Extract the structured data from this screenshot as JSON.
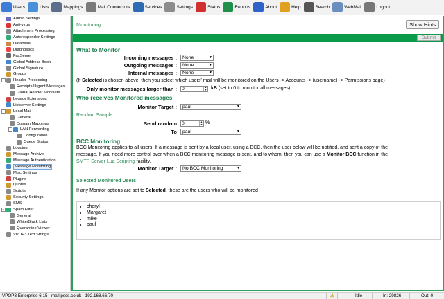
{
  "toolbar": [
    {
      "name": "users",
      "label": "Users",
      "color": "#3b7dd8"
    },
    {
      "name": "lists",
      "label": "Lists",
      "color": "#4a90d9"
    },
    {
      "name": "mappings",
      "label": "Mappings",
      "color": "#5c6e8a"
    },
    {
      "name": "mail-connectors",
      "label": "Mail Connectors",
      "color": "#7a7a7a"
    },
    {
      "name": "services",
      "label": "Services",
      "color": "#2d6bb5"
    },
    {
      "name": "settings",
      "label": "Settings",
      "color": "#8c8c8c"
    },
    {
      "name": "status",
      "label": "Status",
      "color": "#d03030"
    },
    {
      "name": "reports",
      "label": "Reports",
      "color": "#1f8f4a"
    },
    {
      "name": "about",
      "label": "About",
      "color": "#2f63c9"
    },
    {
      "name": "help",
      "label": "Help",
      "color": "#e0a020"
    },
    {
      "name": "search",
      "label": "Search",
      "color": "#555555"
    },
    {
      "name": "webmail",
      "label": "WebMail",
      "color": "#6a8fbf"
    },
    {
      "name": "logout",
      "label": "Logout",
      "color": "#777777"
    }
  ],
  "sidebar": [
    {
      "label": "Admin Settings",
      "level": 0,
      "exp": "",
      "color": "#6a6ac8"
    },
    {
      "label": "Anti-virus",
      "level": 0,
      "exp": "",
      "color": "#d33"
    },
    {
      "label": "Attachment Processing",
      "level": 0,
      "exp": "",
      "color": "#888"
    },
    {
      "label": "Autoresponder Settings",
      "level": 0,
      "exp": "",
      "color": "#3a7"
    },
    {
      "label": "Database",
      "level": 0,
      "exp": "",
      "color": "#c84"
    },
    {
      "label": "Diagnostics",
      "level": 0,
      "exp": "",
      "color": "#e44"
    },
    {
      "label": "FaxServer",
      "level": 0,
      "exp": "",
      "color": "#666"
    },
    {
      "label": "Global Address Book",
      "level": 0,
      "exp": "",
      "color": "#48c"
    },
    {
      "label": "Global Signature",
      "level": 0,
      "exp": "",
      "color": "#888"
    },
    {
      "label": "Groups",
      "level": 0,
      "exp": "",
      "color": "#c93"
    },
    {
      "label": "Header Processing",
      "level": 0,
      "exp": "−",
      "color": "#888"
    },
    {
      "label": "Receipts/Urgent Messages",
      "level": 1,
      "exp": "",
      "color": "#888"
    },
    {
      "label": "Global Header Modifiers",
      "level": 1,
      "exp": "",
      "color": "#888"
    },
    {
      "label": "Legacy Extensions",
      "level": 0,
      "exp": "",
      "color": "#c44"
    },
    {
      "label": "Listserver Settings",
      "level": 0,
      "exp": "",
      "color": "#48c"
    },
    {
      "label": "Local Mail",
      "level": 0,
      "exp": "−",
      "color": "#c93"
    },
    {
      "label": "General",
      "level": 1,
      "exp": "",
      "color": "#888"
    },
    {
      "label": "Domain Mappings",
      "level": 1,
      "exp": "",
      "color": "#888"
    },
    {
      "label": "LAN Forwarding",
      "level": 1,
      "exp": "−",
      "color": "#48c"
    },
    {
      "label": "Configuration",
      "level": 2,
      "exp": "",
      "color": "#888"
    },
    {
      "label": "Queue Status",
      "level": 2,
      "exp": "",
      "color": "#888"
    },
    {
      "label": "Logging",
      "level": 0,
      "exp": "",
      "color": "#888"
    },
    {
      "label": "Message Archive",
      "level": 0,
      "exp": "",
      "color": "#c93"
    },
    {
      "label": "Message Authentication",
      "level": 0,
      "exp": "",
      "color": "#3a7"
    },
    {
      "label": "Message Monitoring",
      "level": 0,
      "exp": "",
      "color": "#48c",
      "selected": true
    },
    {
      "label": "Misc Settings",
      "level": 0,
      "exp": "",
      "color": "#888"
    },
    {
      "label": "Plugins",
      "level": 0,
      "exp": "",
      "color": "#c44"
    },
    {
      "label": "Quotas",
      "level": 0,
      "exp": "",
      "color": "#c93"
    },
    {
      "label": "Scripts",
      "level": 0,
      "exp": "",
      "color": "#888"
    },
    {
      "label": "Security Settings",
      "level": 0,
      "exp": "",
      "color": "#c93"
    },
    {
      "label": "SMS",
      "level": 0,
      "exp": "",
      "color": "#888"
    },
    {
      "label": "Spam Filter",
      "level": 0,
      "exp": "−",
      "color": "#3a7"
    },
    {
      "label": "General",
      "level": 1,
      "exp": "",
      "color": "#888"
    },
    {
      "label": "White/Black Lists",
      "level": 1,
      "exp": "",
      "color": "#888"
    },
    {
      "label": "Quarantine Viewer",
      "level": 1,
      "exp": "",
      "color": "#888"
    },
    {
      "label": "VPOP3 Text Strings",
      "level": 0,
      "exp": "",
      "color": "#888"
    }
  ],
  "main": {
    "title": "Monitoring",
    "hints_label": "Show Hints",
    "submit_label": "Submit",
    "what_heading": "What to Monitor",
    "incoming_label": "Incoming messages :",
    "incoming_value": "None",
    "outgoing_label": "Outgoing messages :",
    "outgoing_value": "None",
    "internal_label": "Internal messages :",
    "internal_value": "None",
    "selected_note_pre": "(If ",
    "selected_note_bold": "Selected",
    "selected_note_post": " is chosen above, then you select which users' mail will be monitored on the Users -> Accounts -> (username) -> Permissions page)",
    "larger_label": "Only monitor messages larger than :",
    "larger_value": "0",
    "larger_unit": "kB",
    "larger_note": "(set to 0 to monitor all messages)",
    "who_heading": "Who receives Monitored messages",
    "target_label": "Monitor Target :",
    "target_value": "paul",
    "random_heading": "Random Sample",
    "send_random_label": "Send random",
    "send_random_value": "0",
    "send_random_unit": "%",
    "to_label": "To",
    "to_value": "paul",
    "bcc_heading": "BCC Monitoring",
    "bcc_text_1": "BCC Monitoring applies to all users. If a message is sent by a local user, using a BCC, then the user below will be notified, and sent a copy of the",
    "bcc_text_2_pre": "message. If you need more control over when a BCC monitoring message is sent, and to whom, then you can use a ",
    "bcc_text_2_bold": "Monitor BCC",
    "bcc_text_2_post": " function in the",
    "bcc_text_3_link": "SMTP Server Lua Scripting",
    "bcc_text_3_post": " facility.",
    "bcc_target_label": "Monitor Target :",
    "bcc_target_value": "No BCC Monitoring",
    "selected_users_heading": "Selected Monitored Users",
    "users_note_pre": "If any Monitor options are set to ",
    "users_note_bold": "Selected",
    "users_note_post": ", these are the users who will be monitored",
    "users": [
      "cheryl",
      "Margaret",
      "mike",
      "paul"
    ]
  },
  "status": {
    "server": "VPOP3 Enterprise 6.15 - mail.pscs.co.uk - 192.168.66.70",
    "state": "Idle",
    "in": "In: 29826",
    "out": "Out: 0"
  }
}
